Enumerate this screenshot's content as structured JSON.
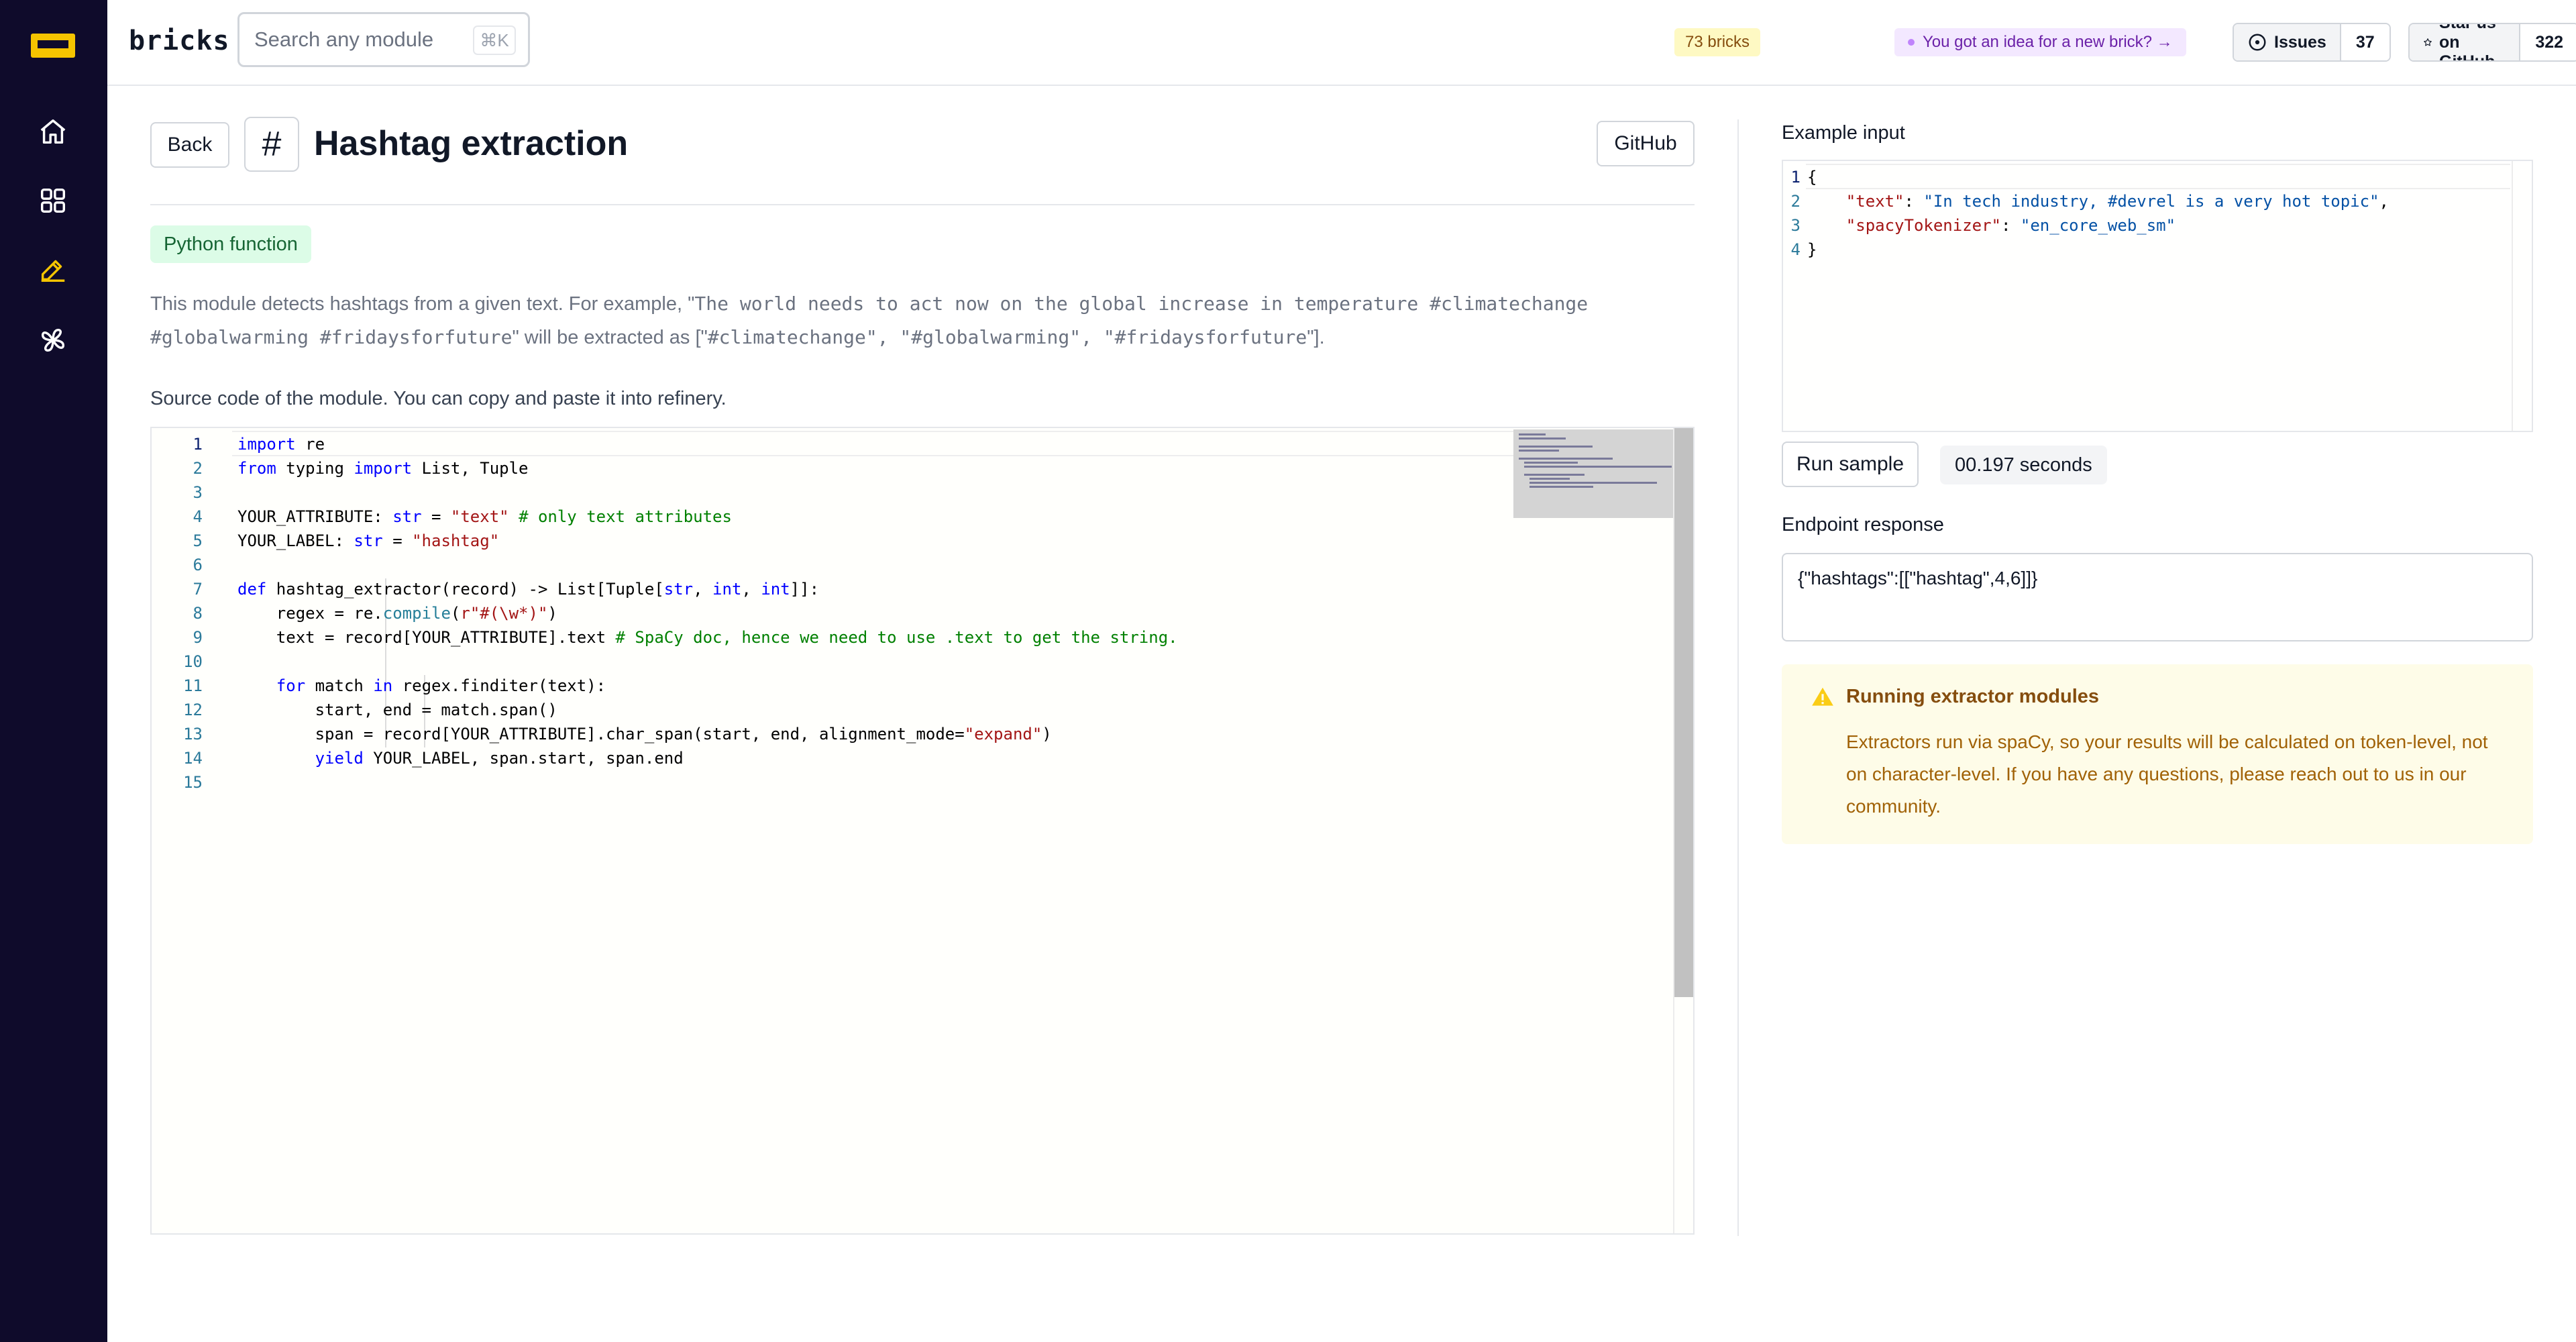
{
  "app": {
    "brand": "bricks",
    "search_placeholder": "Search any module",
    "search_shortcut": "⌘K",
    "bricks_count": "73 bricks",
    "idea_link": "You got an idea for a new brick? →",
    "issues_label": "Issues",
    "issues_count": "37",
    "star_label": "Star us on GitHub",
    "star_count": "322"
  },
  "sidebar": {
    "items": [
      {
        "icon": "home-icon"
      },
      {
        "icon": "grid-icon"
      },
      {
        "icon": "pencil-icon",
        "active": true
      },
      {
        "icon": "pinwheel-icon"
      }
    ]
  },
  "page": {
    "back_label": "Back",
    "icon_glyph": "#",
    "title": "Hashtag extraction",
    "github_label": "GitHub",
    "type_badge": "Python function",
    "desc_prefix": "This module detects hashtags from a given text. For example, \"",
    "desc_example": "The world needs to act now on the global increase in temperature #climatechange #globalwarming #fridaysforfuture",
    "desc_middle": "\" will be extracted as [\"",
    "desc_result": "#climatechange\", \"#globalwarming\", \"#fridaysforfuture",
    "desc_suffix": "\"].",
    "source_label": "Source code of the module. You can copy and paste it into refinery."
  },
  "code": {
    "lines": [
      "import re",
      "from typing import List, Tuple",
      "",
      "YOUR_ATTRIBUTE: str = \"text\" # only text attributes",
      "YOUR_LABEL: str = \"hashtag\"",
      "",
      "def hashtag_extractor(record) -> List[Tuple[str, int, int]]:",
      "    regex = re.compile(r\"#(\\w*)\")",
      "    text = record[YOUR_ATTRIBUTE].text # SpaCy doc, hence we need to use .text to get the string.",
      "",
      "    for match in regex.finditer(text):",
      "        start, end = match.span()",
      "        span = record[YOUR_ATTRIBUTE].char_span(start, end, alignment_mode=\"expand\")",
      "        yield YOUR_LABEL, span.start, span.end",
      ""
    ]
  },
  "right": {
    "example_label": "Example input",
    "example_lines": [
      "{",
      "    \"text\": \"In tech industry, #devrel is a very hot topic\",",
      "    \"spacyTokenizer\": \"en_core_web_sm\"",
      "}"
    ],
    "run_label": "Run sample",
    "timing": "00.197 seconds",
    "response_label": "Endpoint response",
    "response_value": "{\"hashtags\":[[\"hashtag\",4,6]]}",
    "alert_title": "Running extractor modules",
    "alert_body": "Extractors run via spaCy, so your results will be calculated on token-level, not on character-level. If you have any questions, please reach out to us in our community."
  },
  "colors": {
    "sidebar_bg": "#0f0b2b",
    "accent_yellow": "#f5c400",
    "badge_green_bg": "#dcfce7",
    "alert_bg": "#fefce8"
  }
}
